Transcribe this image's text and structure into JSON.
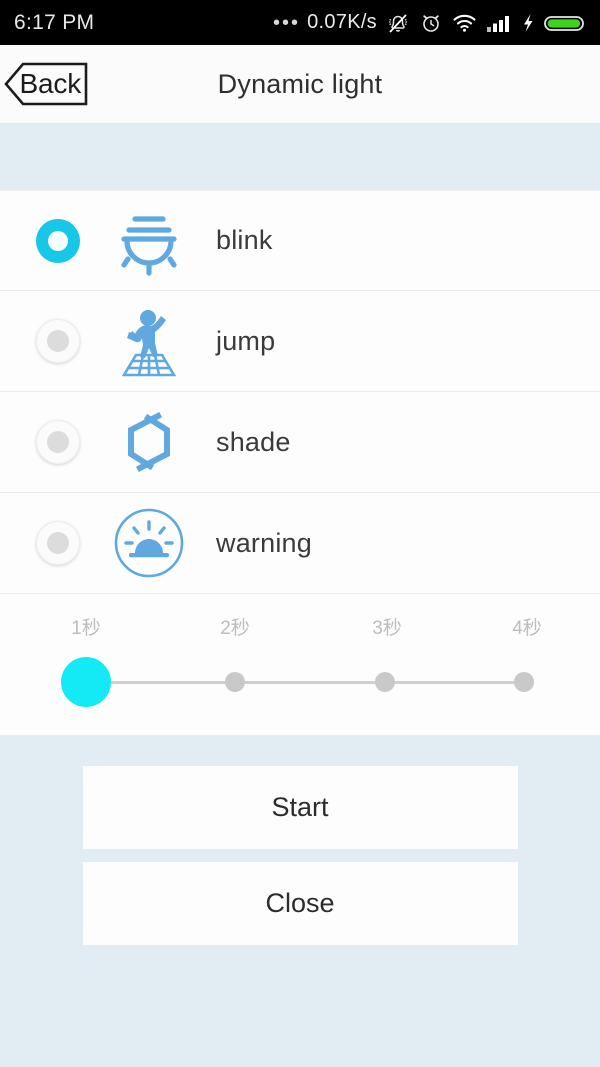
{
  "status_bar": {
    "time": "6:17 PM",
    "dots": "•••",
    "net_speed": "0.07K/s",
    "icons": [
      "mute-bell-icon",
      "alarm-clock-icon",
      "wifi-icon",
      "signal-bars-icon",
      "charging-bolt-icon",
      "battery-icon"
    ],
    "battery_color": "#3fd320"
  },
  "titlebar": {
    "back_label": "Back",
    "title": "Dynamic light"
  },
  "modes": {
    "items": [
      {
        "label": "blink",
        "icon": "lamp-blink-icon",
        "selected": true
      },
      {
        "label": "jump",
        "icon": "dancer-jump-icon",
        "selected": false
      },
      {
        "label": "shade",
        "icon": "hexagon-shade-icon",
        "selected": false
      },
      {
        "label": "warning",
        "icon": "beacon-warning-icon",
        "selected": false
      }
    ]
  },
  "slider": {
    "labels": [
      "1秒",
      "2秒",
      "3秒",
      "4秒"
    ],
    "value_index": 0,
    "value_label": "1秒",
    "thumb_color": "#14eaf5",
    "track_color": "#cfcfcf"
  },
  "actions": {
    "start_label": "Start",
    "close_label": "Close"
  },
  "colors": {
    "accent": "#16c7e8",
    "icon_blue": "#5fa8e0",
    "page_bg": "#e2edf3",
    "card_bg": "#fdfdfd"
  }
}
